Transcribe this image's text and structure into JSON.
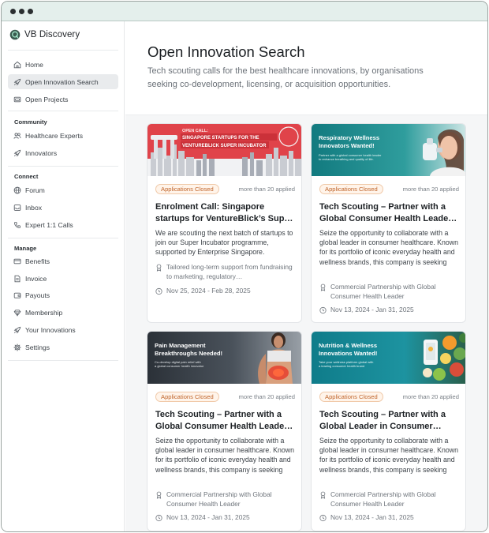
{
  "app": {
    "name": "VB Discovery"
  },
  "sidebar": {
    "top": [
      {
        "label": "Home",
        "icon": "home-icon"
      },
      {
        "label": "Open Innovation Search",
        "icon": "rocket-icon",
        "active": true
      },
      {
        "label": "Open Projects",
        "icon": "folder-icon"
      }
    ],
    "sections": [
      {
        "title": "Community",
        "items": [
          {
            "label": "Healthcare Experts",
            "icon": "people-icon"
          },
          {
            "label": "Innovators",
            "icon": "rocket-icon"
          }
        ]
      },
      {
        "title": "Connect",
        "items": [
          {
            "label": "Forum",
            "icon": "globe-icon"
          },
          {
            "label": "Inbox",
            "icon": "inbox-icon"
          },
          {
            "label": "Expert 1:1 Calls",
            "icon": "phone-icon"
          }
        ]
      },
      {
        "title": "Manage",
        "items": [
          {
            "label": "Benefits",
            "icon": "card-icon"
          },
          {
            "label": "Invoice",
            "icon": "document-icon"
          },
          {
            "label": "Payouts",
            "icon": "wallet-icon"
          },
          {
            "label": "Membership",
            "icon": "diamond-icon"
          },
          {
            "label": "Your Innovations",
            "icon": "rocket-icon"
          },
          {
            "label": "Settings",
            "icon": "gear-icon"
          }
        ]
      }
    ]
  },
  "main": {
    "title": "Open Innovation Search",
    "subtitle": "Tech scouting calls for the best healthcare innovations, by organisations seeking co-development, licensing, or acquisition opportunities."
  },
  "cards": [
    {
      "banner": {
        "line1": "OPEN CALL:",
        "line2": "SINGAPORE STARTUPS FOR THE",
        "line3": "VENTUREBLICK SUPER INCUBATOR"
      },
      "status": "Applications Closed",
      "applied": "more than 20 applied",
      "title": "Enrolment Call: Singapore startups for VentureBlick’s Sup…",
      "description": "We are scouting the next batch of startups to join our Super Incubator programme, supported by Enterprise Singapore.",
      "detail": "Tailored long-term support from fundraising to marketing, regulatory…",
      "dates": "Nov 25, 2024 - Feb 28, 2025"
    },
    {
      "banner": {
        "line1": "Respiratory Wellness",
        "line2": "Innovators Wanted!",
        "caption1": "Partner with a global consumer health leader",
        "caption2": "to enhance breathing and quality of life."
      },
      "status": "Applications Closed",
      "applied": "more than 20 applied",
      "title": "Tech Scouting – Partner with a Global Consumer Health Leade…",
      "description": "Seize the opportunity to collaborate with a global leader in consumer healthcare. Known for its portfolio of iconic everyday health and wellness brands, this company is seeking innovative solutions to help…",
      "detail": "Commercial Partnership with Global Consumer Health Leader",
      "dates": "Nov 13, 2024 - Jan 31, 2025"
    },
    {
      "banner": {
        "line1": "Pain Management",
        "line2": "Breakthroughs Needed!",
        "caption1": "Co-develop digital pain relief with",
        "caption2": "a global consumer health innovator"
      },
      "status": "Applications Closed",
      "applied": "more than 20 applied",
      "title": "Tech Scouting – Partner with a Global Consumer Health Leade…",
      "description": "Seize the opportunity to collaborate with a global leader in consumer healthcare. Known for its portfolio of iconic everyday health and wellness brands, this company is seeking innovative solutions to support…",
      "detail": "Commercial Partnership with Global Consumer Health Leader",
      "dates": "Nov 13, 2024 - Jan 31, 2025"
    },
    {
      "banner": {
        "line1": "Nutrition & Wellness",
        "line2": "Innovations Wanted!",
        "caption1": "Take your wellness platform global with",
        "caption2": "a leading consumer health brand"
      },
      "status": "Applications Closed",
      "applied": "more than 20 applied",
      "title": "Tech Scouting – Partner with a Global Leader in Consumer…",
      "description": "Seize the opportunity to collaborate with a global leader in consumer healthcare. Known for its portfolio of iconic everyday health and wellness brands, this company is seeking innovative wellness solutions th…",
      "detail": "Commercial Partnership with Global Consumer Health Leader",
      "dates": "Nov 13, 2024 - Jan 31, 2025"
    }
  ]
}
